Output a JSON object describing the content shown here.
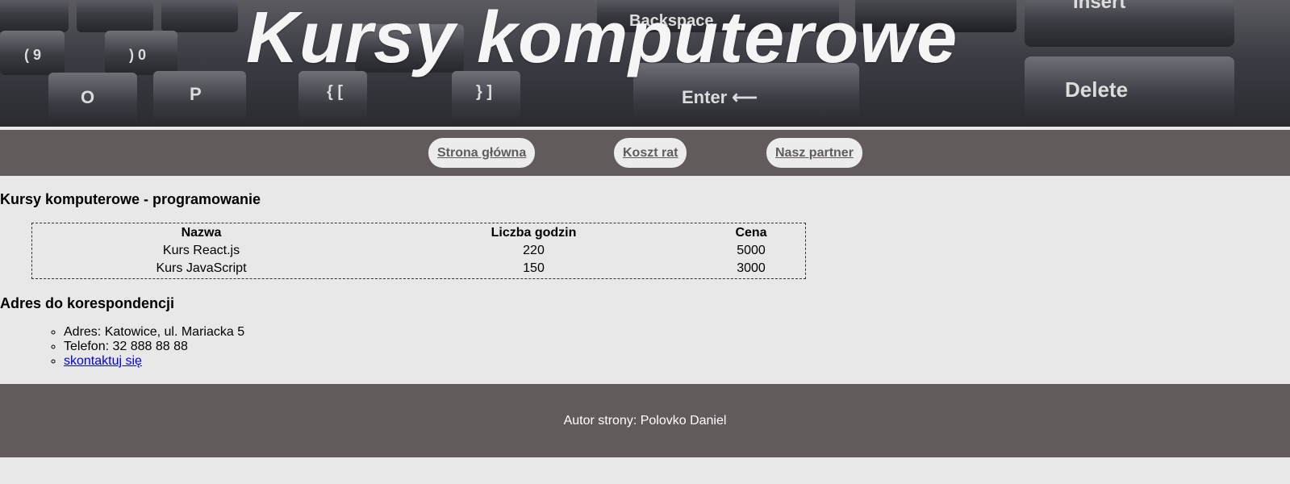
{
  "banner": {
    "title": "Kursy komputerowe"
  },
  "nav": {
    "items": [
      {
        "label": "Strona główna"
      },
      {
        "label": "Koszt rat"
      },
      {
        "label": "Nasz partner"
      }
    ]
  },
  "main": {
    "courses_heading": "Kursy komputerowe - programowanie",
    "table": {
      "headers": [
        "Nazwa",
        "Liczba godzin",
        "Cena"
      ],
      "rows": [
        [
          "Kurs React.js",
          "220",
          "5000"
        ],
        [
          "Kurs JavaScript",
          "150",
          "3000"
        ]
      ]
    },
    "address_heading": "Adres do korespondencji",
    "contact": {
      "address": "Adres: Katowice, ul. Mariacka 5",
      "phone": "Telefon: 32 888 88 88",
      "link": "skontaktuj się"
    }
  },
  "footer": {
    "text": "Autor strony: Polovko Daniel"
  },
  "colors": {
    "nav_background": "#625b5b",
    "page_background": "#e8e8e8",
    "button_background": "#ececec",
    "link": "#0000ee"
  }
}
